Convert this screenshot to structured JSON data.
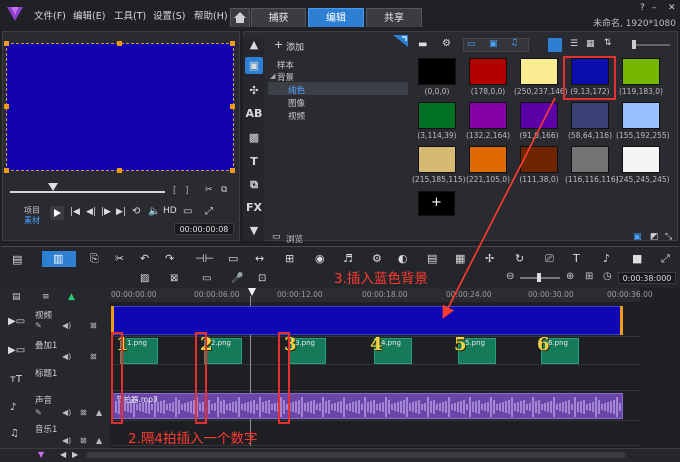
{
  "menu": [
    "文件(F)",
    "编辑(E)",
    "工具(T)",
    "设置(S)",
    "帮助(H)"
  ],
  "tabs": [
    "捕获",
    "编辑",
    "共享"
  ],
  "project_info": "未命名, 1920*1080",
  "preview": {
    "mode_project": "项目",
    "mode_clip": "素材",
    "timecode": "00:00:00:08"
  },
  "library": {
    "add_label": "添加",
    "tree": [
      "样本",
      "背景",
      "纯色",
      "图像",
      "视频"
    ],
    "browse_label": "浏览",
    "swatches": [
      {
        "label": "(0,0,0)",
        "color": "#000000"
      },
      {
        "label": "(178,0,0)",
        "color": "#b20000"
      },
      {
        "label": "(250,237,146)",
        "color": "#faed92"
      },
      {
        "label": "(9,13,172)",
        "color": "#090dac"
      },
      {
        "label": "(119,183,0)",
        "color": "#77b700"
      },
      {
        "label": "(3,114,39)",
        "color": "#037227"
      },
      {
        "label": "(132,2,164)",
        "color": "#8402a4"
      },
      {
        "label": "(91,0,166)",
        "color": "#5b00a6"
      },
      {
        "label": "(58,64,116)",
        "color": "#3a4074"
      },
      {
        "label": "(155,192,255)",
        "color": "#9bc0ff"
      },
      {
        "label": "(215,185,115)",
        "color": "#d7b973"
      },
      {
        "label": "(221,105,0)",
        "color": "#dd6900"
      },
      {
        "label": "(111,38,0)",
        "color": "#6f2600"
      },
      {
        "label": "(116,116,116)",
        "color": "#747474"
      },
      {
        "label": "(245,245,245)",
        "color": "#f5f5f5"
      }
    ]
  },
  "timeline": {
    "timecode": "0:00:38:000",
    "ruler": [
      "00:00:00.00",
      "00:00:06.00",
      "00:00:12.00",
      "00:00:18.00",
      "00:00:24.00",
      "00:00:30.00",
      "00:00:36.00"
    ],
    "tracks": [
      "视频",
      "叠加1",
      "标题1",
      "声音",
      "音乐1"
    ],
    "audio_clip": "节拍器.mp3",
    "overlay_clips": [
      {
        "num": "1",
        "name": "1.png"
      },
      {
        "num": "2",
        "name": "2.png"
      },
      {
        "num": "3",
        "name": "3.png"
      },
      {
        "num": "4",
        "name": "4.png"
      },
      {
        "num": "5",
        "name": "5.png"
      },
      {
        "num": "6",
        "name": "6.png"
      }
    ]
  },
  "annotations": {
    "insert_bg": "3.插入蓝色背景",
    "insert_num": "2.隔4拍插入一个数字"
  }
}
